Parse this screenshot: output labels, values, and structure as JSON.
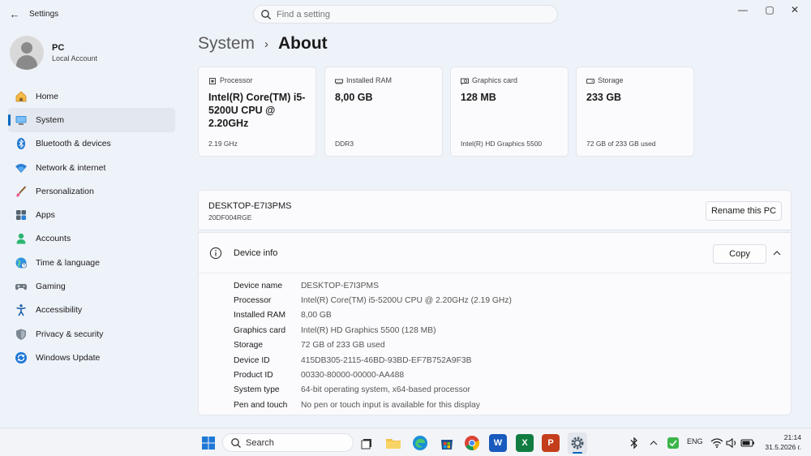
{
  "window": {
    "title": "Settings",
    "search_placeholder": "Find a setting",
    "minimize": "—",
    "maximize": "▢",
    "close": "✕",
    "back": "←"
  },
  "profile": {
    "name": "PC",
    "account_type": "Local Account"
  },
  "sidebar": {
    "items": [
      {
        "label": "Home",
        "icon": "home-icon",
        "active": false
      },
      {
        "label": "System",
        "icon": "system-icon",
        "active": true
      },
      {
        "label": "Bluetooth & devices",
        "icon": "bluetooth-icon",
        "active": false
      },
      {
        "label": "Network & internet",
        "icon": "wifi-icon",
        "active": false
      },
      {
        "label": "Personalization",
        "icon": "brush-icon",
        "active": false
      },
      {
        "label": "Apps",
        "icon": "apps-icon",
        "active": false
      },
      {
        "label": "Accounts",
        "icon": "accounts-icon",
        "active": false
      },
      {
        "label": "Time & language",
        "icon": "globe-icon",
        "active": false
      },
      {
        "label": "Gaming",
        "icon": "gamepad-icon",
        "active": false
      },
      {
        "label": "Accessibility",
        "icon": "accessibility-icon",
        "active": false
      },
      {
        "label": "Privacy & security",
        "icon": "shield-icon",
        "active": false
      },
      {
        "label": "Windows Update",
        "icon": "update-icon",
        "active": false
      }
    ]
  },
  "breadcrumb": {
    "parent": "System",
    "separator": "›",
    "current": "About"
  },
  "specs": [
    {
      "label": "Processor",
      "value": "Intel(R) Core(TM) i5-5200U CPU @ 2.20GHz",
      "detail": "2.19 GHz",
      "icon": "processor-icon"
    },
    {
      "label": "Installed RAM",
      "value": "8,00 GB",
      "detail": "DDR3",
      "icon": "ram-icon"
    },
    {
      "label": "Graphics card",
      "value": "128 MB",
      "detail": "Intel(R) HD Graphics 5500",
      "icon": "graphics-card-icon"
    },
    {
      "label": "Storage",
      "value": "233 GB",
      "detail": "72 GB of 233 GB used",
      "icon": "storage-icon"
    }
  ],
  "pc": {
    "name": "DESKTOP-E7I3PMS",
    "model": "20DF004RGE",
    "rename_label": "Rename this PC"
  },
  "device_info": {
    "title": "Device info",
    "copy_label": "Copy",
    "rows": [
      {
        "key": "Device name",
        "value": "DESKTOP-E7I3PMS"
      },
      {
        "key": "Processor",
        "value": "Intel(R) Core(TM) i5-5200U CPU @ 2.20GHz (2.19 GHz)"
      },
      {
        "key": "Installed RAM",
        "value": "8,00 GB"
      },
      {
        "key": "Graphics card",
        "value": "Intel(R) HD Graphics 5500 (128 MB)"
      },
      {
        "key": "Storage",
        "value": "72 GB of 233 GB used"
      },
      {
        "key": "Device ID",
        "value": "415DB305-2115-46BD-93BD-EF7B752A9F3B"
      },
      {
        "key": "Product ID",
        "value": "00330-80000-00000-AA488"
      },
      {
        "key": "System type",
        "value": "64-bit operating system, x64-based processor"
      },
      {
        "key": "Pen and touch",
        "value": "No pen or touch input is available for this display"
      }
    ]
  },
  "taskbar": {
    "search_label": "Search",
    "language": "ENG",
    "time": "21:14",
    "date": "31.5.2026 г.",
    "colors": {
      "accent": "#0067c0"
    }
  }
}
